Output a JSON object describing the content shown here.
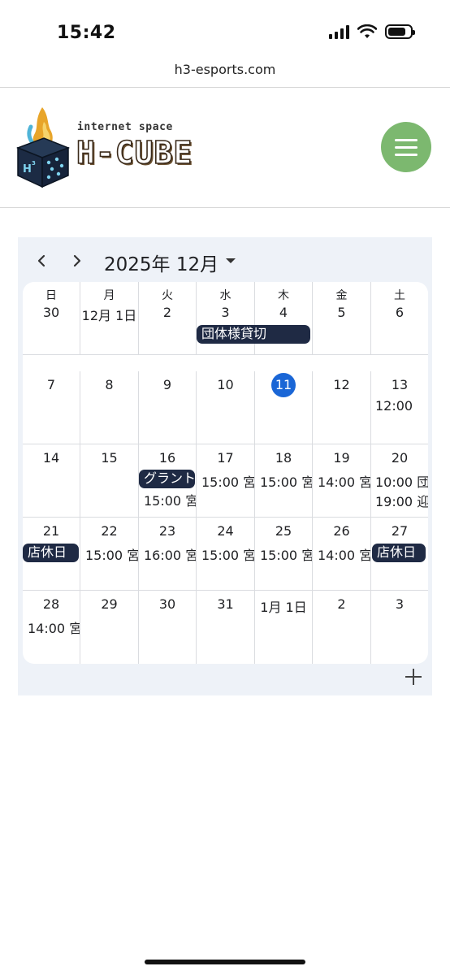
{
  "status_bar": {
    "time": "15:42",
    "battery_level": 0.8
  },
  "browser": {
    "url": "h3-esports.com"
  },
  "header": {
    "logo_subtitle": "internet space",
    "logo_title": "H-CUBE",
    "brand_green": "#7cb86f"
  },
  "calendar": {
    "title": "2025年 12月",
    "accent_color": "#1a66d6",
    "chip_color": "#1f2a44",
    "weekdays": [
      "日",
      "月",
      "火",
      "水",
      "木",
      "金",
      "土"
    ],
    "weeks": [
      {
        "days": [
          "30",
          "12月 1日",
          "2",
          "3",
          "4",
          "5",
          "6"
        ]
      },
      {
        "days": [
          "7",
          "8",
          "9",
          "10",
          "11",
          "12",
          "13"
        ]
      },
      {
        "days": [
          "14",
          "15",
          "16",
          "17",
          "18",
          "19",
          "20"
        ]
      },
      {
        "days": [
          "21",
          "22",
          "23",
          "24",
          "25",
          "26",
          "27"
        ]
      },
      {
        "days": [
          "28",
          "29",
          "30",
          "31",
          "1月 1日",
          "2",
          "3"
        ]
      }
    ],
    "events": {
      "w0_chip": "団体様貸切",
      "w1_sat": "12:00",
      "w2_tue_chip": "グラント",
      "w2_tue": "15:00 宮",
      "w2_wed": "15:00 宮",
      "w2_thu": "15:00 宮",
      "w2_fri": "14:00 宮",
      "w2_sat1": "10:00 団",
      "w2_sat2": "19:00 迎",
      "w3_sun_chip": "店休日",
      "w3_mon": "15:00 宮",
      "w3_tue": "16:00 宮",
      "w3_wed": "15:00 宮",
      "w3_thu": "15:00 宮",
      "w3_fri": "14:00 宮",
      "w3_sat_chip": "店休日",
      "w4_sun": "14:00 宮"
    }
  }
}
